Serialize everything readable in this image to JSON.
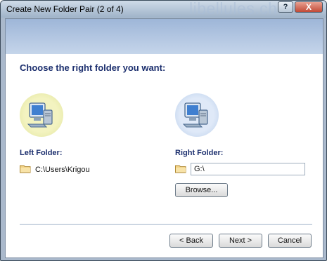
{
  "window": {
    "title": "Create New Folder Pair (2 of 4)",
    "watermark": "libellules.ch",
    "help_label": "?",
    "close_label": "X"
  },
  "heading": "Choose the right folder you want:",
  "left_folder": {
    "label": "Left Folder:",
    "path": "C:\\Users\\Krigou"
  },
  "right_folder": {
    "label": "Right Folder:",
    "path_value": "G:\\",
    "browse_label": "Browse..."
  },
  "buttons": {
    "back": "< Back",
    "next": "Next >",
    "cancel": "Cancel"
  },
  "icons": [
    "computer-icon",
    "folder-icon",
    "help-icon",
    "close-icon"
  ],
  "colors": {
    "heading": "#1c2f6e",
    "header_band": "#b4c6e2",
    "close": "#c24a36"
  }
}
